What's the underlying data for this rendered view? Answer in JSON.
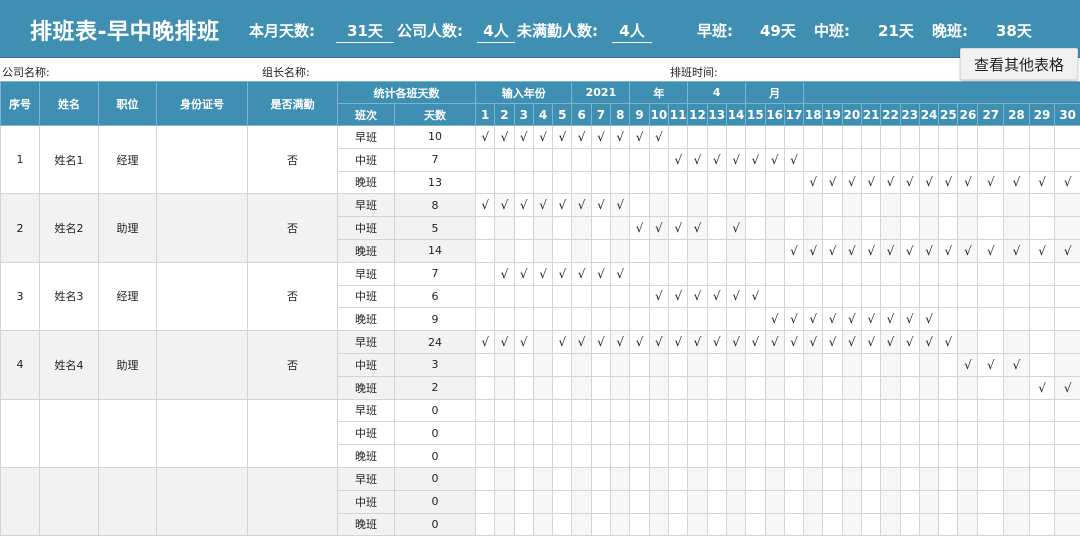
{
  "banner": {
    "title": "排班表-早中晚排班",
    "month_days_label": "本月天数:",
    "month_days_value": "31天",
    "company_people_label": "公司人数:",
    "company_people_value": "4人",
    "not_full_label": "未满勤人数:",
    "not_full_value": "4人",
    "morning_label": "早班:",
    "morning_value": "49天",
    "middle_label": "中班:",
    "middle_value": "21天",
    "night_label": "晚班:",
    "night_value": "38天"
  },
  "other_tables_button": "查看其他表格",
  "info": {
    "company_label": "公司名称:",
    "leader_label": "组长名称:",
    "schedule_time_label": "排班时间:"
  },
  "headers": {
    "index": "序号",
    "name": "姓名",
    "position": "职位",
    "id_card": "身份证号",
    "full_attendance": "是否满勤",
    "stats": "统计各班天数",
    "shift": "班次",
    "days": "天数",
    "input_year": "输入年份",
    "year_value": "2021",
    "year_unit": "年",
    "month_value": "4",
    "month_unit": "月"
  },
  "day_numbers": [
    "1",
    "2",
    "3",
    "4",
    "5",
    "6",
    "7",
    "8",
    "9",
    "10",
    "11",
    "12",
    "13",
    "14",
    "15",
    "16",
    "17",
    "18",
    "19",
    "20",
    "21",
    "22",
    "23",
    "24",
    "25",
    "26",
    "27",
    "28",
    "29",
    "30"
  ],
  "check_mark": "√",
  "employees": [
    {
      "index": "1",
      "name": "姓名1",
      "position": "经理",
      "id": "",
      "full": "否",
      "shifts": [
        {
          "label": "早班",
          "days": "10",
          "on": [
            1,
            2,
            3,
            4,
            5,
            6,
            7,
            8,
            9,
            10
          ]
        },
        {
          "label": "中班",
          "days": "7",
          "on": [
            11,
            12,
            13,
            14,
            15,
            16,
            17
          ]
        },
        {
          "label": "晚班",
          "days": "13",
          "on": [
            18,
            19,
            20,
            21,
            22,
            23,
            24,
            25,
            26,
            27,
            28,
            29,
            30
          ]
        }
      ]
    },
    {
      "index": "2",
      "name": "姓名2",
      "position": "助理",
      "id": "",
      "full": "否",
      "shifts": [
        {
          "label": "早班",
          "days": "8",
          "on": [
            1,
            2,
            3,
            4,
            5,
            6,
            7,
            8
          ]
        },
        {
          "label": "中班",
          "days": "5",
          "on": [
            9,
            10,
            11,
            12,
            14
          ]
        },
        {
          "label": "晚班",
          "days": "14",
          "on": [
            17,
            18,
            19,
            20,
            21,
            22,
            23,
            24,
            25,
            26,
            27,
            28,
            29,
            30
          ]
        }
      ]
    },
    {
      "index": "3",
      "name": "姓名3",
      "position": "经理",
      "id": "",
      "full": "否",
      "shifts": [
        {
          "label": "早班",
          "days": "7",
          "on": [
            2,
            3,
            4,
            5,
            6,
            7,
            8
          ]
        },
        {
          "label": "中班",
          "days": "6",
          "on": [
            10,
            11,
            12,
            13,
            14,
            15
          ]
        },
        {
          "label": "晚班",
          "days": "9",
          "on": [
            16,
            17,
            18,
            19,
            20,
            21,
            22,
            23,
            24
          ]
        }
      ]
    },
    {
      "index": "4",
      "name": "姓名4",
      "position": "助理",
      "id": "",
      "full": "否",
      "shifts": [
        {
          "label": "早班",
          "days": "24",
          "on": [
            1,
            2,
            3,
            5,
            6,
            7,
            8,
            9,
            10,
            11,
            12,
            13,
            14,
            15,
            16,
            17,
            18,
            19,
            20,
            21,
            22,
            23,
            24,
            25
          ]
        },
        {
          "label": "中班",
          "days": "3",
          "on": [
            26,
            27,
            28
          ]
        },
        {
          "label": "晚班",
          "days": "2",
          "on": [
            29,
            30
          ]
        }
      ]
    },
    {
      "index": "",
      "name": "",
      "position": "",
      "id": "",
      "full": "",
      "shifts": [
        {
          "label": "早班",
          "days": "0",
          "on": []
        },
        {
          "label": "中班",
          "days": "0",
          "on": []
        },
        {
          "label": "晚班",
          "days": "0",
          "on": []
        }
      ]
    },
    {
      "index": "",
      "name": "",
      "position": "",
      "id": "",
      "full": "",
      "shifts": [
        {
          "label": "早班",
          "days": "0",
          "on": []
        },
        {
          "label": "中班",
          "days": "0",
          "on": []
        },
        {
          "label": "晚班",
          "days": "0",
          "on": []
        }
      ]
    }
  ]
}
